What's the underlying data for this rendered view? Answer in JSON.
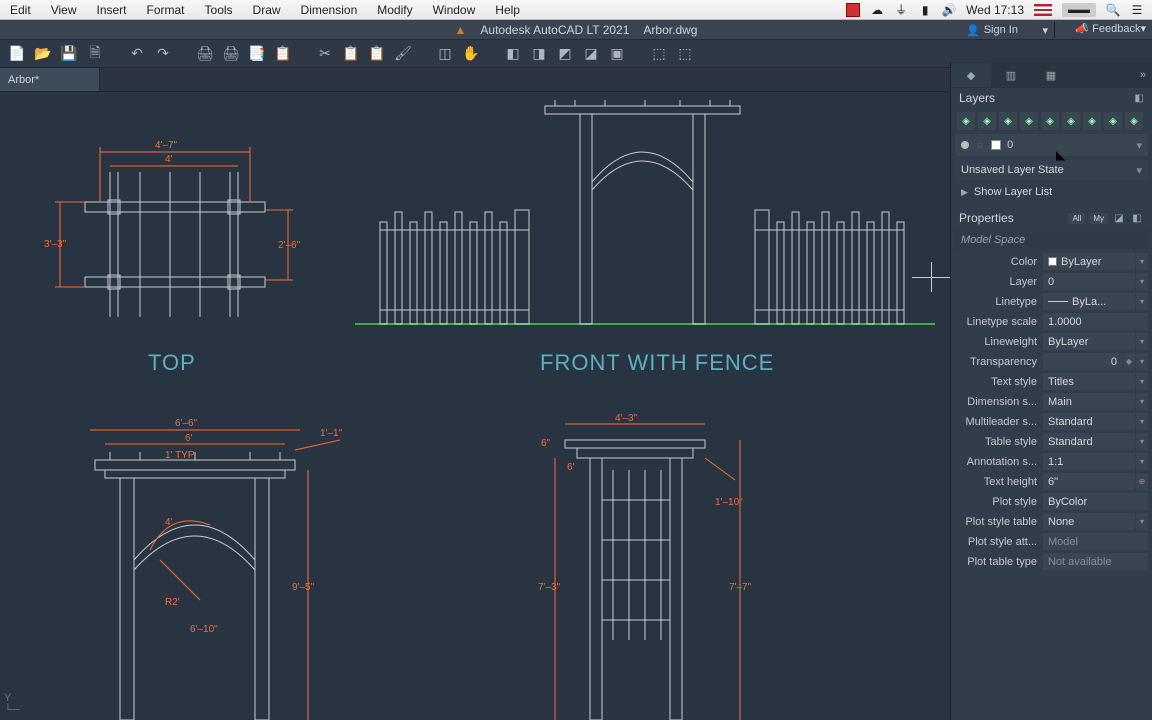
{
  "menubar": {
    "items": [
      "Edit",
      "View",
      "Insert",
      "Format",
      "Tools",
      "Draw",
      "Dimension",
      "Modify",
      "Window",
      "Help"
    ],
    "clock": "Wed 17:13"
  },
  "titlebar": {
    "app": "Autodesk AutoCAD LT 2021",
    "file": "Arbor.dwg",
    "signin": "Sign In",
    "feedback": "Feedback"
  },
  "doctab": "Arbor*",
  "views": {
    "top": "TOP",
    "frontfence": "FRONT WITH FENCE"
  },
  "dims": {
    "top_w1": "4'–7\"",
    "top_w2": "4'",
    "top_h1": "3'–3\"",
    "top_h2": "2'–6\"",
    "fl_w1": "6'–6\"",
    "fl_w2": "6'",
    "fl_typ": "1' TYP",
    "fl_ext": "1'–1\"",
    "fl_r": "R2'",
    "fl_a": "4'",
    "fl_side": "9'–5\"",
    "fl_ht": "6'–10\"",
    "fr_top": "4'–3\"",
    "fr_6": "6\"",
    "fr_1_10": "1'–10\"",
    "fr_7_3": "7'–3\"",
    "fr_7_7": "7'–7\"",
    "fr_6_2": "6'"
  },
  "layers": {
    "title": "Layers",
    "current": "0",
    "state": "Unsaved Layer State",
    "showlist": "Show Layer List"
  },
  "properties": {
    "title": "Properties",
    "all": "All",
    "my": "My",
    "context": "Model Space",
    "rows": {
      "color_l": "Color",
      "color_v": "ByLayer",
      "layer_l": "Layer",
      "layer_v": "0",
      "ltype_l": "Linetype",
      "ltype_v": "ByLa...",
      "ltscale_l": "Linetype scale",
      "ltscale_v": "1.0000",
      "lweight_l": "Lineweight",
      "lweight_v": "ByLayer",
      "transp_l": "Transparency",
      "transp_v": "0",
      "txtstyle_l": "Text style",
      "txtstyle_v": "Titles",
      "dimstyle_l": "Dimension s...",
      "dimstyle_v": "Main",
      "mleader_l": "Multileader s...",
      "mleader_v": "Standard",
      "tblstyle_l": "Table style",
      "tblstyle_v": "Standard",
      "annoscale_l": "Annotation s...",
      "annoscale_v": "1:1",
      "txtheight_l": "Text height",
      "txtheight_v": "6\"",
      "plotstyle_l": "Plot style",
      "plotstyle_v": "ByColor",
      "plottable_l": "Plot style table",
      "plottable_v": "None",
      "plotatt_l": "Plot style att...",
      "plotatt_v": "Model",
      "plottype_l": "Plot table type",
      "plottype_v": "Not available"
    }
  },
  "ucs": "Y"
}
